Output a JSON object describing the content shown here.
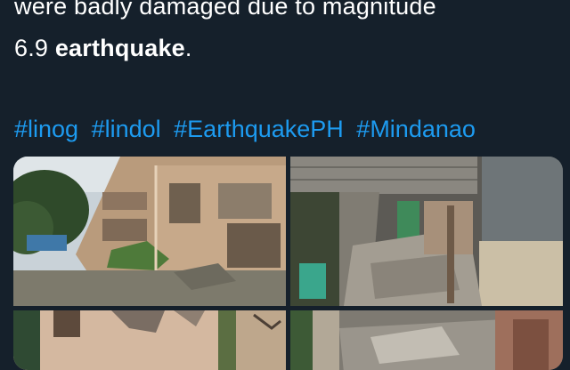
{
  "tweet": {
    "line_1": "were badly damaged due to magnitude",
    "line_2_prefix": "6.9 ",
    "line_2_bold": "earthquake",
    "line_2_suffix": "."
  },
  "hashtags": [
    "#linog",
    "#lindol",
    "#EarthquakePH",
    "#Mindanao"
  ],
  "colors": {
    "background": "#15202b",
    "text": "#ffffff",
    "link": "#1d9bf0"
  },
  "media": {
    "photos": [
      {
        "subject": "damaged-school-building-exterior"
      },
      {
        "subject": "collapsed-corridor-rubble"
      },
      {
        "subject": "cracked-building-wall"
      },
      {
        "subject": "debris-pile"
      }
    ]
  }
}
